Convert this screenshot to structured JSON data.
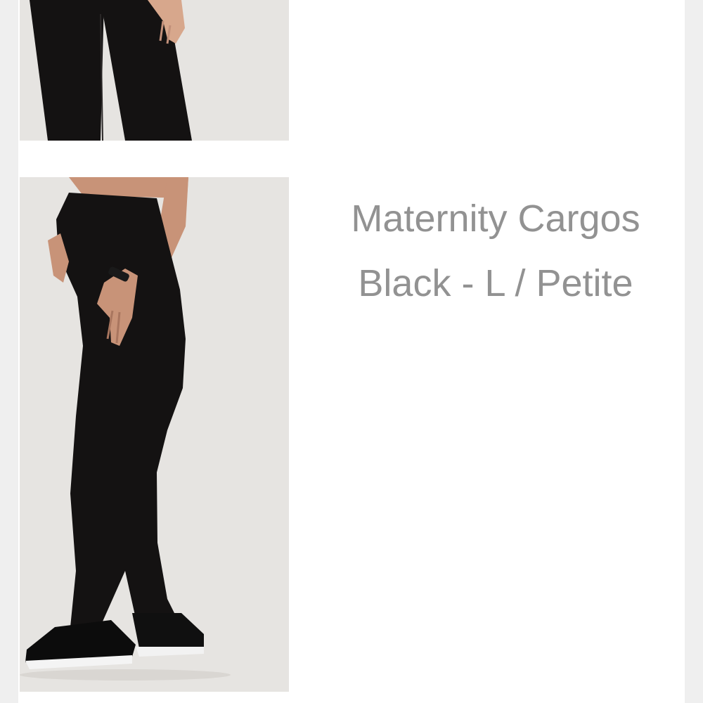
{
  "product": {
    "title": "Maternity Cargos",
    "variant": "Black - L / Petite"
  },
  "colors": {
    "text": "#929292",
    "page_background": "#ffffff",
    "outer_background": "#efefef",
    "photo_background": "#e6e4e1",
    "garment": "#141212"
  },
  "images": [
    {
      "name": "product-photo-top",
      "depicts": "cropped view of black pants legs"
    },
    {
      "name": "product-photo-main",
      "depicts": "side view of model wearing black maternity pants with white-soled black sneakers"
    }
  ]
}
